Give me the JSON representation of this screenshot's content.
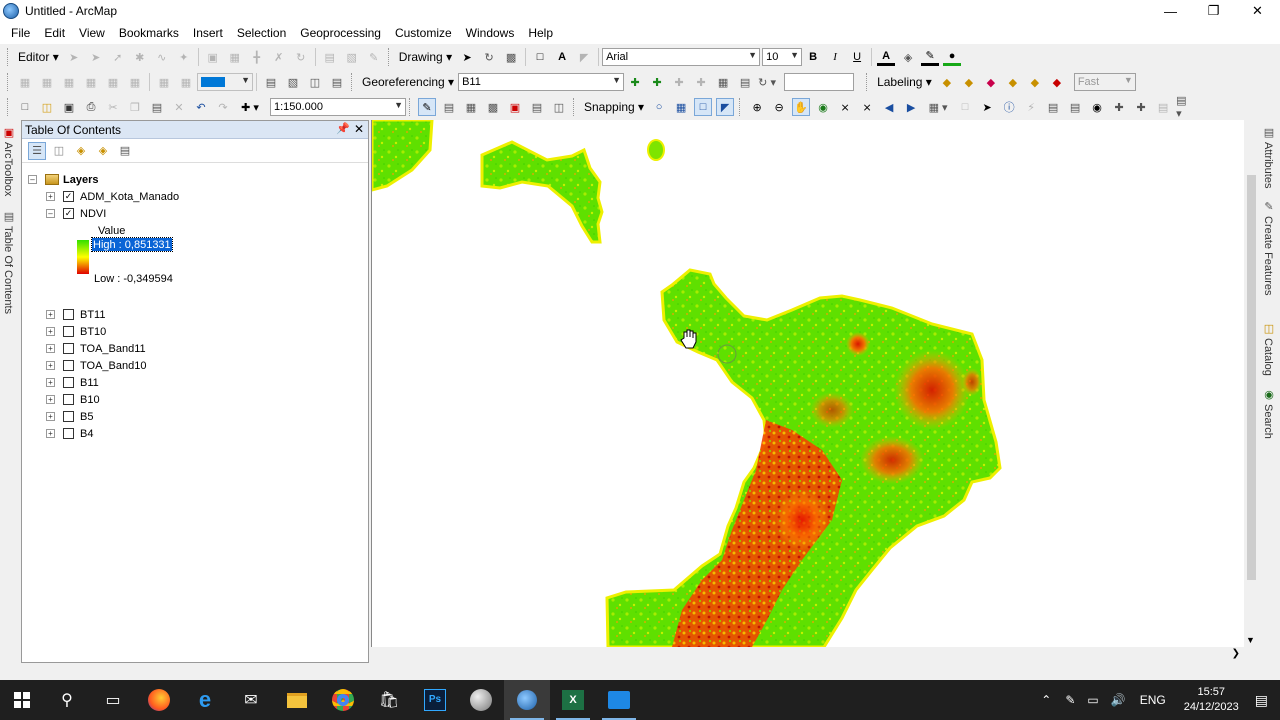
{
  "window": {
    "title": "Untitled - ArcMap"
  },
  "menu": [
    "File",
    "Edit",
    "View",
    "Bookmarks",
    "Insert",
    "Selection",
    "Geoprocessing",
    "Customize",
    "Windows",
    "Help"
  ],
  "toolbar1": {
    "editor_label": "Editor",
    "drawing_label": "Drawing",
    "font_name": "Arial",
    "font_size": "10",
    "bold": "B",
    "italic": "I",
    "underline": "U",
    "font_color_glyph": "A"
  },
  "toolbar2": {
    "georef_label": "Georeferencing",
    "georef_layer": "B11",
    "labeling_label": "Labeling",
    "fast_label": "Fast"
  },
  "toolbar3": {
    "scale": "1:150.000",
    "snapping_label": "Snapping"
  },
  "toc": {
    "title": "Table Of Contents",
    "root": "Layers",
    "legend_header": "Value",
    "legend_high": "High : 0,851331",
    "legend_low": "Low : -0,349594",
    "layers": [
      {
        "name": "ADM_Kota_Manado",
        "checked": true
      },
      {
        "name": "NDVI",
        "checked": true
      },
      {
        "name": "BT11",
        "checked": false
      },
      {
        "name": "BT10",
        "checked": false
      },
      {
        "name": "TOA_Band11",
        "checked": false
      },
      {
        "name": "TOA_Band10",
        "checked": false
      },
      {
        "name": "B11",
        "checked": false
      },
      {
        "name": "B10",
        "checked": false
      },
      {
        "name": "B5",
        "checked": false
      },
      {
        "name": "B4",
        "checked": false
      }
    ]
  },
  "side_left": [
    "ArcToolbox",
    "Table Of Contents"
  ],
  "side_right": [
    "Attributes",
    "Create Features",
    "Catalog",
    "Search"
  ],
  "colors": {
    "ndvi_high": "#33e000",
    "ndvi_mid": "#ffff00",
    "ndvi_low": "#e00000",
    "toc_header": "#dbe6f4"
  },
  "taskbar": {
    "time": "15:57",
    "date": "24/12/2023",
    "lang": "ENG"
  }
}
